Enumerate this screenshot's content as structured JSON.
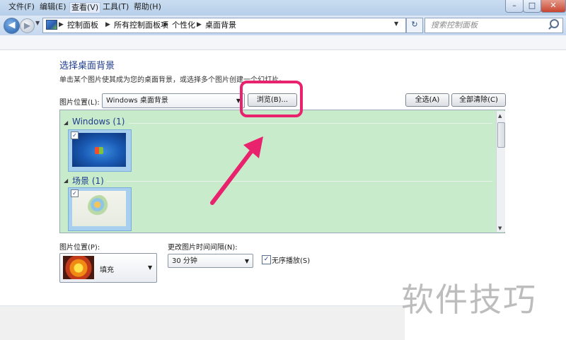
{
  "window": {
    "min_symbol": "–",
    "max_symbol": "□",
    "close_symbol": "✕"
  },
  "nav": {
    "back_symbol": "◀",
    "forward_symbol": "▶",
    "breadcrumbs": [
      "控制面板",
      "所有控制面板项",
      "个性化",
      "桌面背景"
    ],
    "refresh_symbol": "↻",
    "search_placeholder": "搜索控制面板"
  },
  "menubar": [
    "文件(F)",
    "编辑(E)",
    "查看(V)",
    "工具(T)",
    "帮助(H)"
  ],
  "content": {
    "title": "选择桌面背景",
    "description": "单击某个图片使其成为您的桌面背景，或选择多个图片创建一个幻灯片。",
    "location_label": "图片位置(L):",
    "location_value": "Windows 桌面背景",
    "browse_button": "浏览(B)...",
    "select_all_button": "全选(A)",
    "clear_all_button": "全部清除(C)"
  },
  "groups": [
    {
      "name": "Windows (1)",
      "checked": true,
      "icon": "windows7-wallpaper"
    },
    {
      "name": "场景 (1)",
      "checked": true,
      "icon": "flower-scene-wallpaper"
    }
  ],
  "options": {
    "position_label": "图片位置(P):",
    "position_value": "填充",
    "interval_label": "更改图片时间间隔(N):",
    "interval_value": "30 分钟",
    "shuffle_label": "无序播放(S)",
    "shuffle_checked": true
  },
  "watermark": "软件技巧",
  "colors": {
    "highlight": "#e8226c",
    "panel_bg": "#c8ebcb",
    "heading": "#1e3c8c"
  }
}
